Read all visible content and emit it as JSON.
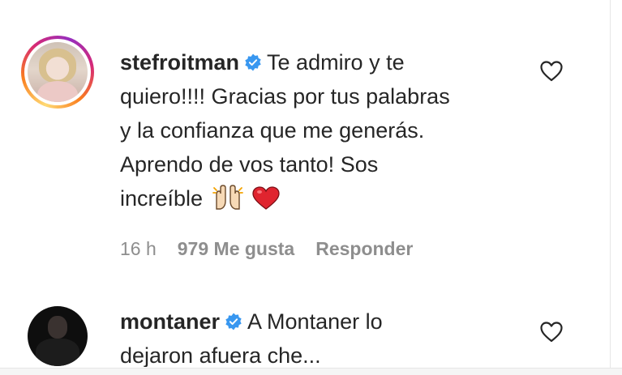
{
  "comments": [
    {
      "username": "stefroitman",
      "text_line1": "Te admiro y te",
      "text_line2": "quiero!!!! Gracias por tus palabras",
      "text_line3": "y la confianza que me generás.",
      "text_line4": "Aprendo de vos tanto! Sos",
      "text_line5": "increíble",
      "emojis": [
        "raising-hands-emoji",
        "red-heart-emoji"
      ],
      "time": "16 h",
      "likes": "979 Me gusta",
      "reply": "Responder"
    },
    {
      "username": "montaner",
      "text_line1": "A Montaner lo",
      "text_line2": "dejaron afuera che..."
    }
  ],
  "colors": {
    "text": "#262626",
    "meta": "#8e8e8e",
    "verified": "#3897f0",
    "heart_emoji": "#e0242f"
  },
  "icons": [
    "verified-badge-icon",
    "heart-outline-icon"
  ]
}
